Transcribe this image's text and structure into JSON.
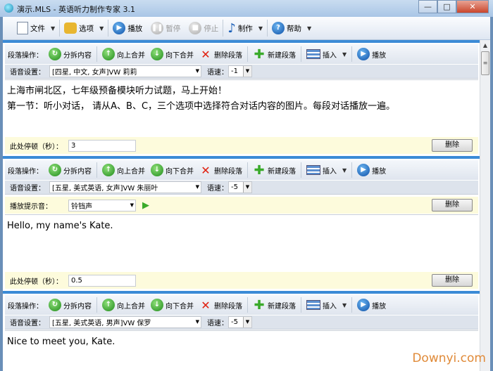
{
  "window": {
    "title": "演示.MLS - 英语听力制作专家 3.1",
    "minimize": "—",
    "maximize": "□",
    "close": "✕"
  },
  "toolbar": {
    "file": "文件",
    "options": "选项",
    "play": "播放",
    "pause": "暂停",
    "stop": "停止",
    "make": "制作",
    "help": "帮助"
  },
  "ops": {
    "label": "段落操作：",
    "split": "分拆内容",
    "merge_up": "向上合并",
    "merge_down": "向下合并",
    "delete_para": "删除段落",
    "new_para": "新建段落",
    "insert": "插入",
    "play": "播放"
  },
  "labels": {
    "voice": "语音设置：",
    "speed": "语速：",
    "pause": "此处停顿（秒）：",
    "prompt": "播放提示音：",
    "delete": "删除"
  },
  "blocks": [
    {
      "voice": "[四星, 中文, 女声]VW 莉莉",
      "speed": "-1",
      "lines": [
        "上海市闸北区，七年级预备模块听力试题，马上开始！",
        "第一节：听小对话， 请从A、B、C，三个选项中选择符合对话内容的图片。每段对话播放一遍。"
      ],
      "pause": "3"
    },
    {
      "voice": "[五星, 美式英语, 女声]VW 朱丽叶",
      "speed": "-5",
      "prompt": "铃铛声",
      "lines": [
        "Hello, my name's Kate."
      ],
      "pause": "0.5"
    },
    {
      "voice": "[五星, 美式英语, 男声]VW 保罗",
      "speed": "-5",
      "lines": [
        "Nice to meet you, Kate."
      ]
    }
  ],
  "watermark": "Downyi.com"
}
